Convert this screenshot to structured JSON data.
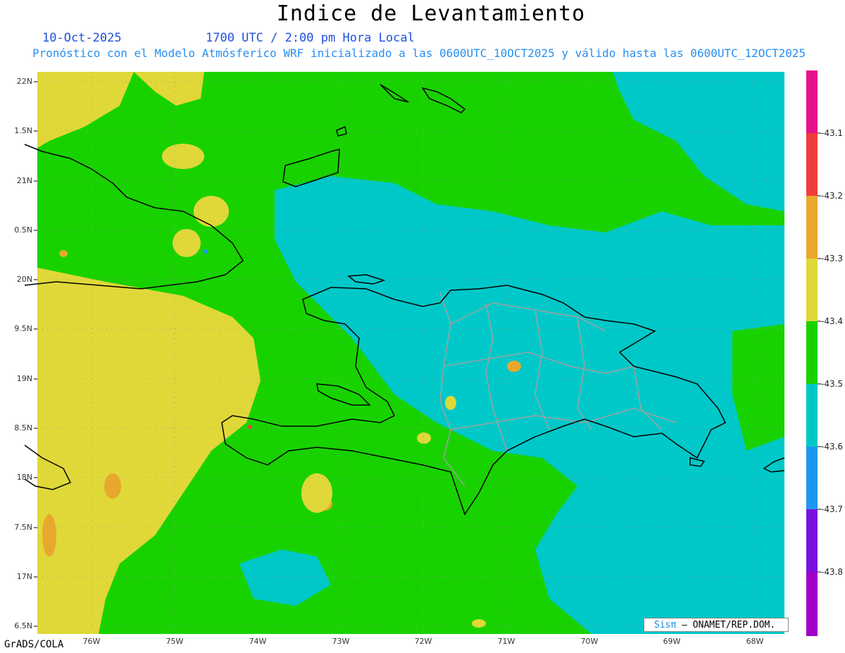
{
  "title": "Indice de Levantamiento",
  "date": "10-Oct-2025",
  "time": "1700 UTC / 2:00 pm Hora Local",
  "subtitle": "Pronóstico con el Modelo Atmósferico WRF inicializado a las 0600UTC_10OCT2025 y válido hasta las  0600UTC_12OCT2025",
  "credit": "GrADS/COLA",
  "logo": {
    "brand": "Sisπ",
    "org": " – ONAMET/REP.DOM."
  },
  "y_axis_labels": [
    "22N",
    "1.5N",
    "21N",
    "0.5N",
    "20N",
    "9.5N",
    "19N",
    "8.5N",
    "18N",
    "7.5N",
    "17N",
    "6.5N"
  ],
  "x_axis_labels": [
    "76W",
    "75W",
    "74W",
    "73W",
    "72W",
    "71W",
    "70W",
    "69W",
    "68W"
  ],
  "colorbar": {
    "labels": [
      "-43.1",
      "-43.2",
      "-43.3",
      "-43.4",
      "-43.5",
      "-43.6",
      "-43.7",
      "-43.8"
    ],
    "colors": [
      "#e8128c",
      "#f03c3c",
      "#e8a82e",
      "#e0d838",
      "#18d200",
      "#00c8c8",
      "#1e96f0",
      "#7a10e0",
      "#a000c8"
    ]
  },
  "field_colors": {
    "yellow": "#e0d838",
    "green": "#18d200",
    "cyan": "#00c8c8",
    "orange": "#e8a82e",
    "red": "#f03c3c",
    "blue": "#1e96f0"
  }
}
